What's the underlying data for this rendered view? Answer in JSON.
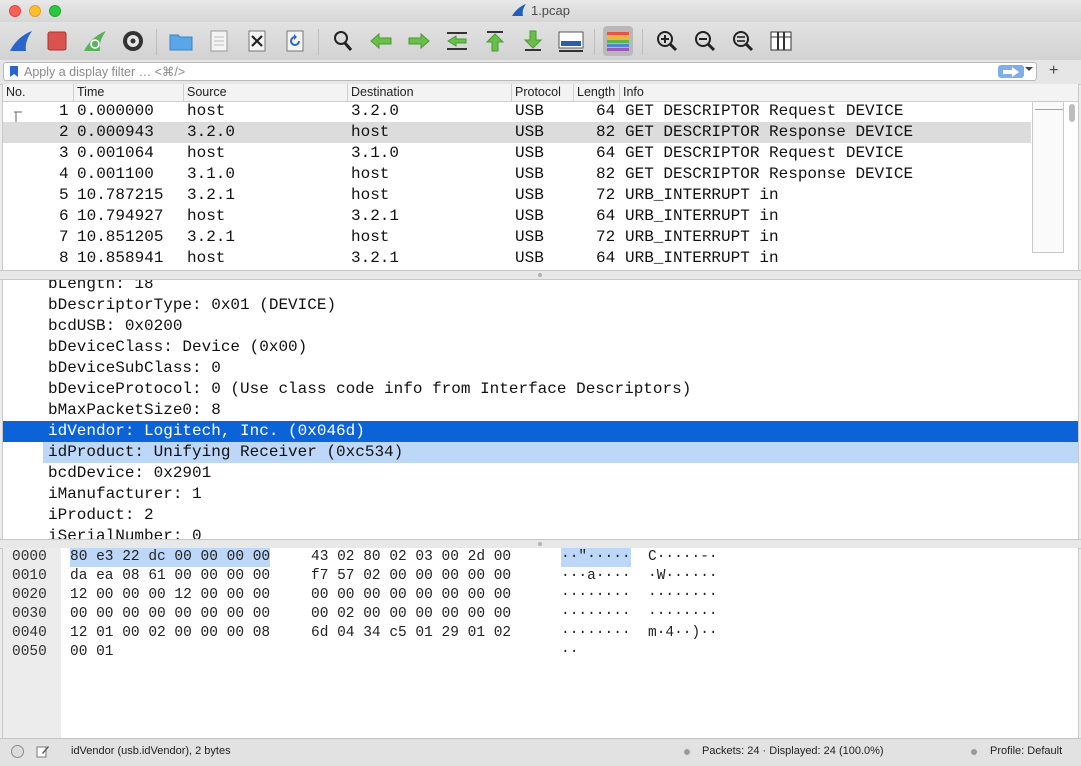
{
  "window": {
    "title": "1.pcap"
  },
  "colors": {
    "accent": "#0c63d8",
    "related_highlight": "#bcd7f7",
    "selected_packet": "#dcdcdc"
  },
  "toolbar": {
    "buttons": [
      "start-capture-icon",
      "stop-capture-icon",
      "restart-capture-icon",
      "capture-options-icon",
      "open-file-icon",
      "save-file-icon",
      "close-file-icon",
      "reload-file-icon",
      "find-packet-icon",
      "go-back-icon",
      "go-forward-icon",
      "go-to-packet-icon",
      "first-packet-icon",
      "last-packet-icon",
      "autoscroll-icon",
      "colorize-icon",
      "zoom-in-icon",
      "zoom-out-icon",
      "normal-size-icon",
      "resize-columns-icon"
    ]
  },
  "filter": {
    "placeholder": "Apply a display filter … <⌘/>",
    "value": ""
  },
  "packet_list": {
    "columns": [
      "No.",
      "Time",
      "Source",
      "Destination",
      "Protocol",
      "Length",
      "Info"
    ],
    "rows": [
      {
        "no": "1",
        "time": "0.000000",
        "source": "host",
        "destination": "3.2.0",
        "protocol": "USB",
        "length": "64",
        "info": "GET DESCRIPTOR Request DEVICE"
      },
      {
        "no": "2",
        "time": "0.000943",
        "source": "3.2.0",
        "destination": "host",
        "protocol": "USB",
        "length": "82",
        "info": "GET DESCRIPTOR Response DEVICE"
      },
      {
        "no": "3",
        "time": "0.001064",
        "source": "host",
        "destination": "3.1.0",
        "protocol": "USB",
        "length": "64",
        "info": "GET DESCRIPTOR Request DEVICE"
      },
      {
        "no": "4",
        "time": "0.001100",
        "source": "3.1.0",
        "destination": "host",
        "protocol": "USB",
        "length": "82",
        "info": "GET DESCRIPTOR Response DEVICE"
      },
      {
        "no": "5",
        "time": "10.787215",
        "source": "3.2.1",
        "destination": "host",
        "protocol": "USB",
        "length": "72",
        "info": "URB_INTERRUPT in"
      },
      {
        "no": "6",
        "time": "10.794927",
        "source": "host",
        "destination": "3.2.1",
        "protocol": "USB",
        "length": "64",
        "info": "URB_INTERRUPT in"
      },
      {
        "no": "7",
        "time": "10.851205",
        "source": "3.2.1",
        "destination": "host",
        "protocol": "USB",
        "length": "72",
        "info": "URB_INTERRUPT in"
      },
      {
        "no": "8",
        "time": "10.858941",
        "source": "host",
        "destination": "3.2.1",
        "protocol": "USB",
        "length": "64",
        "info": "URB_INTERRUPT in"
      }
    ]
  },
  "details": {
    "lines": [
      "bLength: 18",
      "bDescriptorType: 0x01 (DEVICE)",
      "bcdUSB: 0x0200",
      "bDeviceClass: Device (0x00)",
      "bDeviceSubClass: 0",
      "bDeviceProtocol: 0 (Use class code info from Interface Descriptors)",
      "bMaxPacketSize0: 8",
      "idVendor: Logitech, Inc. (0x046d)",
      "idProduct: Unifying Receiver (0xc534)",
      "bcdDevice: 0x2901",
      "iManufacturer: 1",
      "iProduct: 2",
      "iSerialNumber: 0"
    ]
  },
  "bytes": {
    "rows": [
      {
        "offset": "0000",
        "hex_hl": "80 e3 22 dc 00 00 00 00",
        "hex1": "",
        "hex2": "43 02 80 02 03 00 2d 00",
        "ascii_hl": "··\"·····",
        "ascii1": "",
        "ascii2": "C·····-·"
      },
      {
        "offset": "0010",
        "hex_hl": "",
        "hex1": "da ea 08 61 00 00 00 00",
        "hex2": "f7 57 02 00 00 00 00 00",
        "ascii_hl": "",
        "ascii1": "···a····",
        "ascii2": "·W······"
      },
      {
        "offset": "0020",
        "hex_hl": "",
        "hex1": "12 00 00 00 12 00 00 00",
        "hex2": "00 00 00 00 00 00 00 00",
        "ascii_hl": "",
        "ascii1": "········",
        "ascii2": "········"
      },
      {
        "offset": "0030",
        "hex_hl": "",
        "hex1": "00 00 00 00 00 00 00 00",
        "hex2": "00 02 00 00 00 00 00 00",
        "ascii_hl": "",
        "ascii1": "········",
        "ascii2": "········"
      },
      {
        "offset": "0040",
        "hex_hl": "",
        "hex1": "12 01 00 02 00 00 00 08",
        "hex2": "6d 04 34 c5 01 29 01 02",
        "ascii_hl": "",
        "ascii1": "········",
        "ascii2": "m·4··)··"
      },
      {
        "offset": "0050",
        "hex_hl": "",
        "hex1": "00 01",
        "hex2": "",
        "ascii_hl": "",
        "ascii1": "··",
        "ascii2": ""
      }
    ]
  },
  "status": {
    "field": "idVendor (usb.idVendor), 2 bytes",
    "packets": "Packets: 24 · Displayed: 24 (100.0%)",
    "profile": "Profile: Default"
  }
}
